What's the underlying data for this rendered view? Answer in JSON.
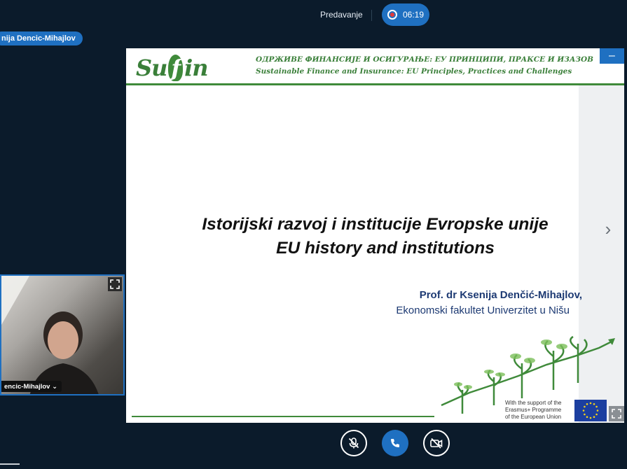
{
  "topbar": {
    "lecture_title": "Predavanje",
    "recording_time": "06:19"
  },
  "presenter": {
    "name_tag": "nija Dencic-Mihajlov"
  },
  "slide": {
    "logo_text": [
      "Su",
      "f",
      "in"
    ],
    "header_serbian": "ОДРЖИВЕ ФИНАНСИЈЕ И ОСИГУРАЊЕ: ЕУ ПРИНЦИПИ, ПРАКСЕ И ИЗАЗОВ",
    "header_english": "Sustainable Finance and Insurance: EU Principles, Practices and Challenges",
    "title_line1": "Istorijski razvoj i institucije Evropske unije",
    "title_line2": "EU history and institutions",
    "author": "Prof. dr Ksenija Denčić-Mihajlov,",
    "affiliation": "Ekonomski fakultet Univerzitet u Nišu",
    "erasmus_line1": "With the support of the",
    "erasmus_line2": "Erasmus+ Programme",
    "erasmus_line3": "of the European Union",
    "minimize_symbol": "–",
    "next_symbol": "›"
  },
  "webcam": {
    "name_label": "encic-Mihajlov ⌄"
  },
  "colors": {
    "accent": "#1f70c1",
    "background": "#0b1b2b",
    "brand_green": "#3f8a3a",
    "author_blue": "#1d3a73"
  },
  "icons": [
    "mic-off-icon",
    "phone-icon",
    "camera-off-icon",
    "fullscreen-icon",
    "chevron-right-icon",
    "record-icon"
  ]
}
